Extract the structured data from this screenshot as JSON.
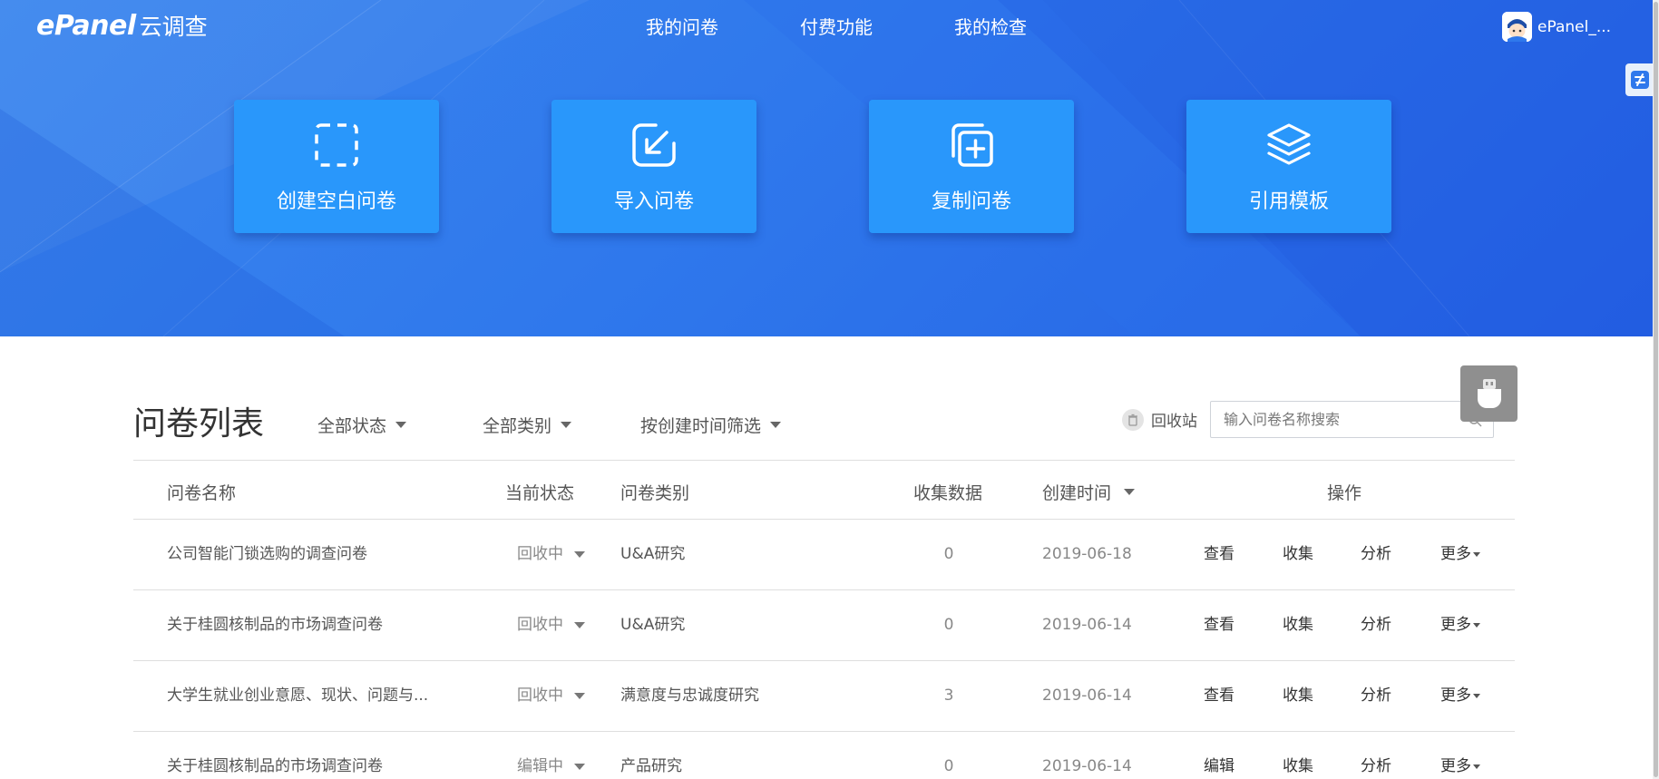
{
  "header": {
    "logo_main": "ePanel",
    "logo_sub": "云调查",
    "nav": [
      {
        "label": "我的问卷"
      },
      {
        "label": "付费功能"
      },
      {
        "label": "我的检查"
      }
    ],
    "user_name": "ePanel_..."
  },
  "actions": [
    {
      "label": "创建空白问卷",
      "icon": "dashed-square-icon"
    },
    {
      "label": "导入问卷",
      "icon": "import-arrow-icon"
    },
    {
      "label": "复制问卷",
      "icon": "copy-plus-icon"
    },
    {
      "label": "引用模板",
      "icon": "layers-icon"
    }
  ],
  "list": {
    "title": "问卷列表",
    "filters": {
      "status": "全部状态",
      "category": "全部类别",
      "time": "按创建时间筛选"
    },
    "recycle_label": "回收站",
    "search_placeholder": "输入问卷名称搜索",
    "columns": {
      "name": "问卷名称",
      "status": "当前状态",
      "category": "问卷类别",
      "count": "收集数据",
      "created": "创建时间",
      "ops": "操作"
    },
    "rows": [
      {
        "name": "公司智能门锁选购的调查问卷",
        "status": "回收中",
        "category": "U&A研究",
        "count": "0",
        "created": "2019-06-18",
        "op1": "查看",
        "op2": "收集",
        "op3": "分析",
        "op4": "更多"
      },
      {
        "name": "关于桂圆核制品的市场调查问卷",
        "status": "回收中",
        "category": "U&A研究",
        "count": "0",
        "created": "2019-06-14",
        "op1": "查看",
        "op2": "收集",
        "op3": "分析",
        "op4": "更多"
      },
      {
        "name": "大学生就业创业意愿、现状、问题与...",
        "status": "回收中",
        "category": "满意度与忠诚度研究",
        "count": "3",
        "created": "2019-06-14",
        "op1": "查看",
        "op2": "收集",
        "op3": "分析",
        "op4": "更多"
      },
      {
        "name": "关于桂圆核制品的市场调查问卷",
        "status": "编辑中",
        "category": "产品研究",
        "count": "0",
        "created": "2019-06-14",
        "op1": "编辑",
        "op2": "收集",
        "op3": "分析",
        "op4": "更多"
      }
    ]
  },
  "colors": {
    "hero_start": "#3b86ee",
    "hero_end": "#2461e4",
    "card": "#2997fb"
  }
}
